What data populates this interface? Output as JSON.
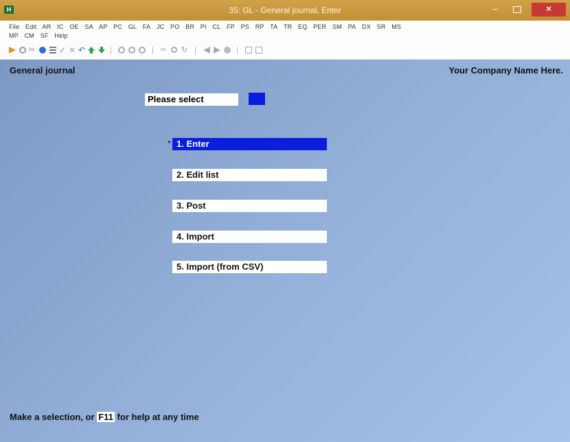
{
  "window": {
    "title": "35: GL - General journal, Enter",
    "icon_glyph": "H",
    "buttons": {
      "minimize": "–",
      "close": "×"
    }
  },
  "menubar": {
    "row1": [
      "File",
      "Edit",
      "AR",
      "IC",
      "OE",
      "SA",
      "AP",
      "PC",
      "GL",
      "FA",
      "JC",
      "PO",
      "BR",
      "PI",
      "CL",
      "FP",
      "PS",
      "RP",
      "TA",
      "TR",
      "EQ",
      "PER",
      "SM",
      "PA",
      "DX",
      "SR",
      "MS"
    ],
    "row2": [
      "MP",
      "CM",
      "SF",
      "Help"
    ]
  },
  "toolbar": {
    "icons": [
      "run-icon",
      "target-icon",
      "cut-icon",
      "settings-icon",
      "list-icon",
      "check-icon",
      "cancel-icon",
      "undo-icon",
      "up-arrow-icon",
      "down-arrow-icon",
      "circle-icon",
      "circle-icon",
      "circle-icon",
      "binoculars-icon",
      "magnifier-icon",
      "refresh-icon",
      "prev-icon",
      "next-icon",
      "stop-icon",
      "print-icon",
      "preview-icon"
    ]
  },
  "header": {
    "left": "General journal",
    "right": "Your Company Name Here."
  },
  "prompt": {
    "label": "Please select",
    "value": ""
  },
  "menu": {
    "marker": "*",
    "options": [
      "1. Enter",
      "2. Edit list",
      "3. Post",
      "4. Import",
      "5. Import (from CSV)"
    ],
    "selected_index": 0
  },
  "footer": {
    "before": "Make a selection, or",
    "key": "F11",
    "after": "for help at any time"
  },
  "colors": {
    "titlebar": "#c8993c",
    "selection": "#0a1fdc",
    "background": "#91aed7",
    "close": "#c73a33"
  }
}
